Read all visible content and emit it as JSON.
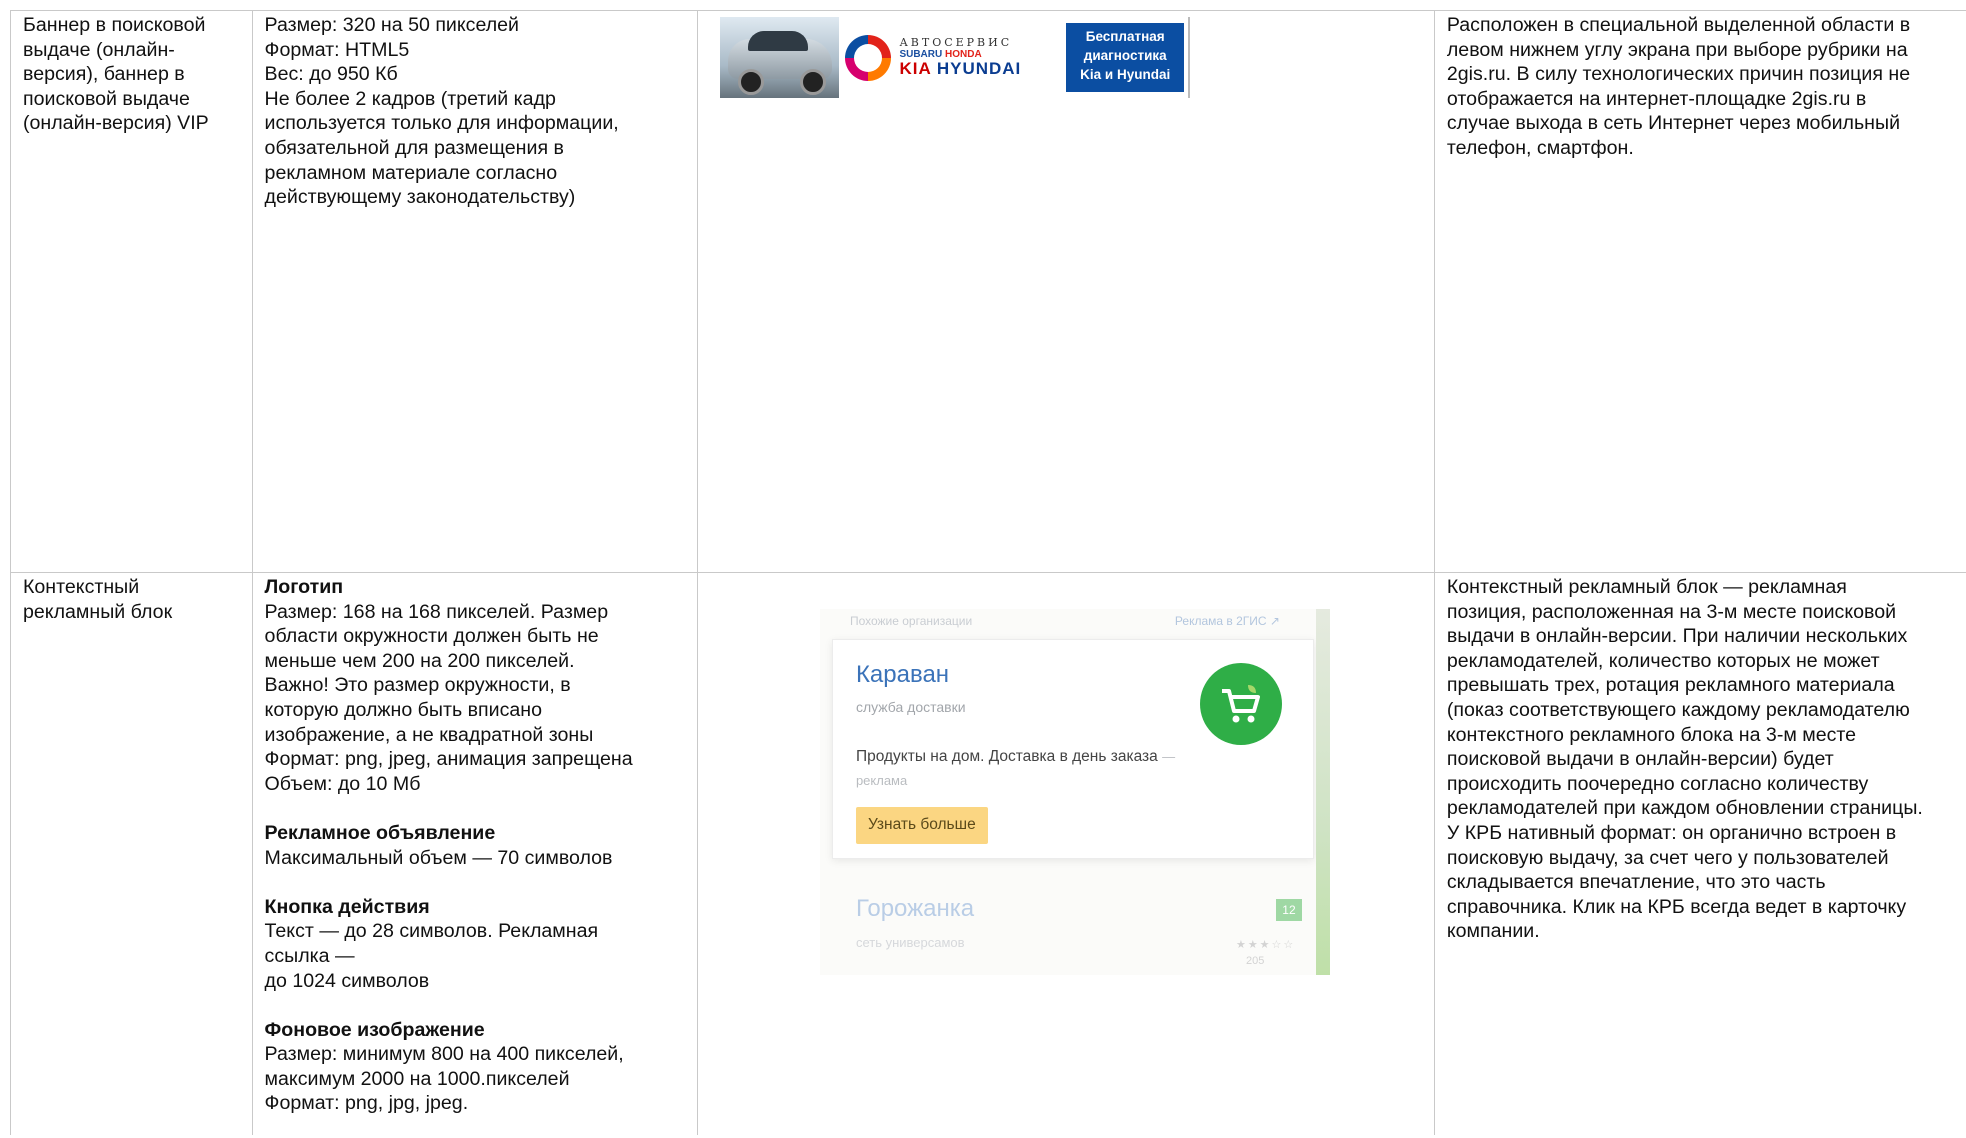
{
  "rows": [
    {
      "name_lines": [
        "Баннер в поисковой",
        "выдаче (онлайн-",
        "версия), баннер в",
        "поисковой выдаче",
        "(онлайн-версия) VIP"
      ],
      "spec_lines": [
        "Размер: 320 на 50 пикселей",
        "Формат: HTML5",
        "Вес: до 950 Кб",
        "Не более 2 кадров (третий кадр",
        "используется только для информации,",
        "обязательной для размещения в",
        "рекламном материале согласно",
        "действующему законодательству)"
      ],
      "banner": {
        "brand_line1": "АВТОСЕРВИС",
        "brand_line2a": "SUBARU",
        "brand_line2b": "HONDA",
        "brand_line3a": "KIA",
        "brand_line3b": "HYUNDAI",
        "promo_line1": "Бесплатная",
        "promo_line2": "диагностика",
        "promo_line3": "Kia и Hyundai"
      },
      "desc_lines": [
        "Расположен в специальной выделенной области в",
        "левом нижнем углу экрана при выборе рубрики на",
        "2gis.ru. В силу технологических причин позиция не",
        "отображается на интернет-площадке 2gis.ru в",
        "случае выхода в сеть Интернет через мобильный",
        "телефон, смартфон."
      ]
    },
    {
      "name_lines": [
        "Контекстный",
        "рекламный блок"
      ],
      "spec": {
        "logo_title": "Логотип",
        "logo_lines": [
          "Размер: 168 на 168 пикселей. Размер",
          "области окружности должен быть не",
          "меньше чем 200 на 200 пикселей.",
          "Важно! Это размер окружности, в",
          "которую должно быть вписано",
          "изображение, а не квадратной зоны",
          "Формат: png, jpeg, анимация запрещена",
          "Объем: до 10 Мб"
        ],
        "ad_title": "Рекламное объявление",
        "ad_lines": [
          "Максимальный объем — 70 символов"
        ],
        "button_title": "Кнопка действия",
        "button_lines": [
          "Текст — до 28 символов. Рекламная",
          "ссылка —",
          "до 1024 символов"
        ],
        "bg_title": "Фоновое изображение",
        "bg_lines": [
          "Размер: минимум 800 на 400 пикселей,",
          "максимум 2000 на 1000.пикселей",
          "Формат: png, jpg, jpeg."
        ]
      },
      "native": {
        "section_label": "Похожие организации",
        "ad_label": "Реклама в 2ГИС ↗",
        "title": "Караван",
        "subtitle": "служба доставки",
        "text": "Продукты на дом. Доставка в день заказа",
        "text_tag": "— реклама",
        "button": "Узнать больше",
        "title2": "Горожанка",
        "subtitle2": "сеть универсамов",
        "badge": "12",
        "reviews": "205"
      },
      "desc_lines": [
        "Контекстный рекламный блок — рекламная",
        "позиция, расположенная на 3-м месте поисковой",
        "выдачи в онлайн-версии. При наличии нескольких",
        "рекламодателей, количество которых не может",
        "превышать трех, ротация рекламного материала",
        "(показ соответствующего каждому рекламодателю",
        "контекстного рекламного блока на 3-м месте",
        "поисковой выдачи в онлайн-версии) будет",
        "происходить поочередно согласно количеству",
        "рекламодателей при каждом обновлении страницы.",
        "У КРБ нативный формат: он органично встроен в",
        "поисковую выдачу, за счет чего у пользователей",
        "складывается впечатление, что это часть",
        "справочника. Клик на КРБ всегда ведет в карточку",
        "компании."
      ]
    }
  ],
  "colors": {
    "border": "#c9c9c9",
    "promo_bg": "#0b4ea2",
    "native_title": "#3b73b9",
    "native_button_bg": "#fbd682",
    "cart_circle": "#2fae47"
  },
  "icons": [
    "car-photo",
    "top-motors-logo",
    "shopping-cart-icon"
  ]
}
